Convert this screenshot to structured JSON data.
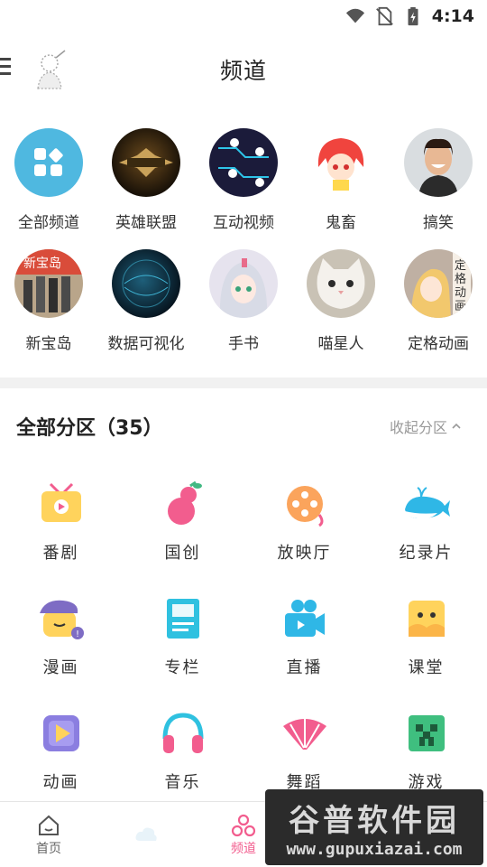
{
  "status": {
    "time": "4:14"
  },
  "header": {
    "title": "频道"
  },
  "channels": [
    {
      "label": "全部频道",
      "icon": "grid-icon"
    },
    {
      "label": "英雄联盟",
      "icon": "lol-logo-icon"
    },
    {
      "label": "互动视频",
      "icon": "circuit-icon"
    },
    {
      "label": "鬼畜",
      "icon": "anime-girl-icon"
    },
    {
      "label": "搞笑",
      "icon": "laughing-man-icon"
    },
    {
      "label": "新宝岛",
      "icon": "group-photo-icon"
    },
    {
      "label": "数据可视化",
      "icon": "globe-icon"
    },
    {
      "label": "手书",
      "icon": "anime-sketch-icon"
    },
    {
      "label": "喵星人",
      "icon": "cat-icon"
    },
    {
      "label": "定格动画",
      "icon": "figure-icon",
      "badge": "定格动画"
    }
  ],
  "zones_header": {
    "title": "全部分区（35）",
    "collapse": "收起分区"
  },
  "zones": [
    {
      "label": "番剧",
      "icon": "tv-icon"
    },
    {
      "label": "国创",
      "icon": "gourd-icon"
    },
    {
      "label": "放映厅",
      "icon": "film-reel-icon"
    },
    {
      "label": "纪录片",
      "icon": "whale-icon"
    },
    {
      "label": "漫画",
      "icon": "beret-face-icon"
    },
    {
      "label": "专栏",
      "icon": "article-icon"
    },
    {
      "label": "直播",
      "icon": "camera-icon"
    },
    {
      "label": "课堂",
      "icon": "classroom-icon"
    },
    {
      "label": "动画",
      "icon": "play-card-icon"
    },
    {
      "label": "音乐",
      "icon": "headphones-icon"
    },
    {
      "label": "舞蹈",
      "icon": "fan-icon"
    },
    {
      "label": "游戏",
      "icon": "creeper-icon"
    }
  ],
  "tabbar": [
    {
      "label": "首页"
    },
    {
      "label": ""
    },
    {
      "label": "频道"
    }
  ],
  "watermark": {
    "line1": "谷普软件园",
    "line2": "www.gupuxiazai.com"
  },
  "colors": {
    "accent": "#f25d8e",
    "blue": "#4fb8e0"
  }
}
